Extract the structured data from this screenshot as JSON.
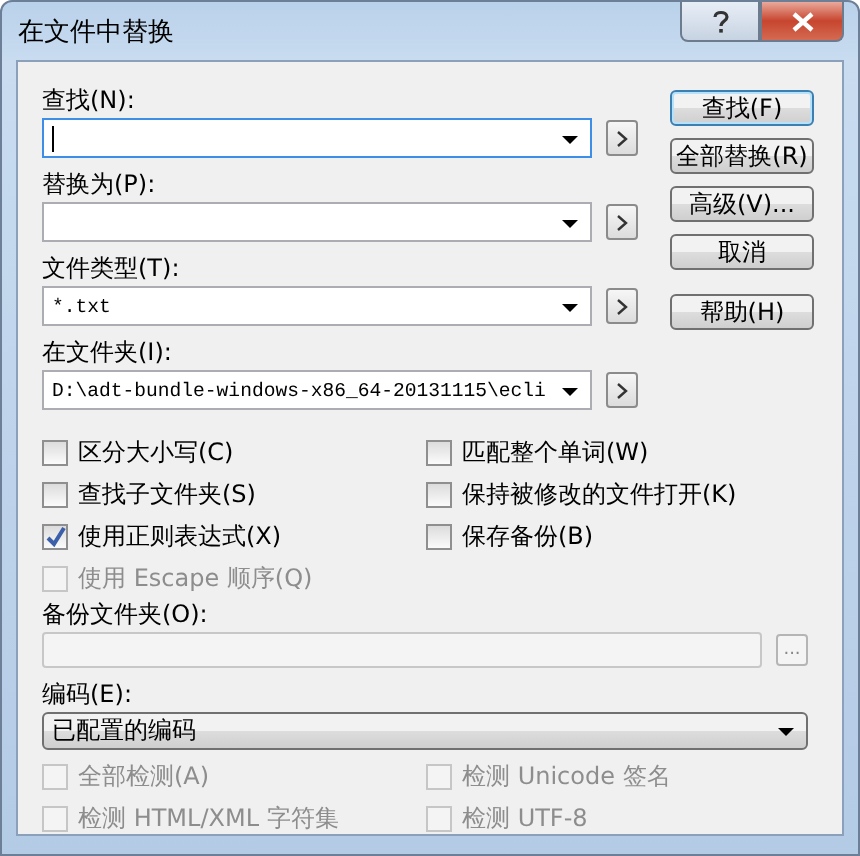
{
  "window": {
    "title": "在文件中替换"
  },
  "fields": [
    {
      "label": "查找(N):",
      "focused": true
    },
    {
      "label": "替换为(P):",
      "focused": false
    },
    {
      "label": "文件类型(T):",
      "value": "*.txt",
      "focused": false
    },
    {
      "label": "在文件夹(I):",
      "value": "D:\\adt-bundle-windows-x86_64-20131115\\ecli",
      "focused": false
    }
  ],
  "buttons": [
    {
      "label": "查找(F)",
      "default": true
    },
    {
      "label": "全部替换(R)",
      "default": false
    },
    {
      "label": "高级(V)...",
      "default": false
    },
    {
      "label": "取消",
      "default": false
    },
    {
      "label": "帮助(H)",
      "default": false
    }
  ],
  "options": [
    {
      "label": "区分大小写(C)",
      "checked": false,
      "disabled": false
    },
    {
      "label": "匹配整个单词(W)",
      "checked": false,
      "disabled": false
    },
    {
      "label": "查找子文件夹(S)",
      "checked": false,
      "disabled": false
    },
    {
      "label": "保持被修改的文件打开(K)",
      "checked": false,
      "disabled": false
    },
    {
      "label": "使用正则表达式(X)",
      "checked": true,
      "disabled": false
    },
    {
      "label": "保存备份(B)",
      "checked": false,
      "disabled": false
    },
    {
      "label": "使用 Escape 顺序(Q)",
      "checked": false,
      "disabled": true
    }
  ],
  "backup_folder": {
    "label": "备份文件夹(O):",
    "browse_label": "...",
    "disabled": true
  },
  "encoding": {
    "label": "编码(E):",
    "value": "已配置的编码"
  },
  "detection": [
    {
      "label": "全部检测(A)",
      "checked": false,
      "disabled": true
    },
    {
      "label": "检测 Unicode 签名",
      "checked": false,
      "disabled": true
    },
    {
      "label": "检测 HTML/XML 字符集",
      "checked": false,
      "disabled": true
    },
    {
      "label": "检测 UTF-8",
      "checked": false,
      "disabled": true
    }
  ]
}
